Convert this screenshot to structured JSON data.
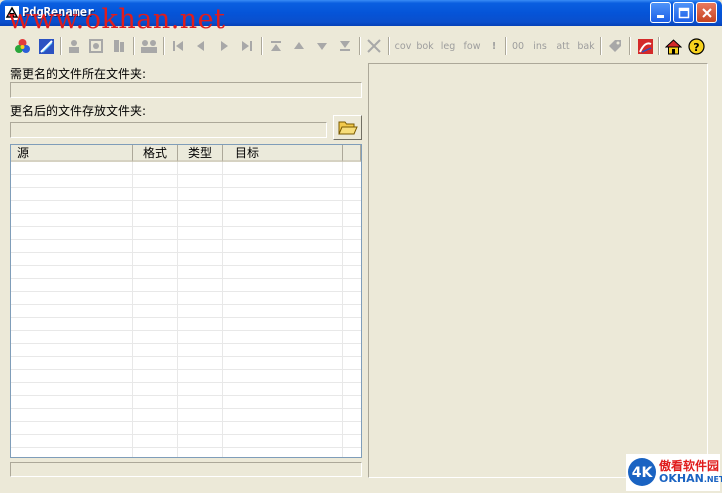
{
  "window": {
    "title": "PdgRenamer",
    "watermark_top": "www.okhan.net",
    "controls": [
      "minimize",
      "maximize",
      "close"
    ]
  },
  "toolbar": {
    "icons": [
      "color-wheel-icon",
      "rename-icon",
      "user-icon",
      "photo-icon",
      "document-icon",
      "group-icon",
      "first-icon",
      "previous-icon",
      "next-icon",
      "last-icon",
      "move-top-icon",
      "move-up-icon",
      "move-down-icon",
      "move-bottom-icon",
      "delete-icon",
      "tag-icon",
      "logo-icon",
      "home-icon",
      "help-icon"
    ],
    "text_buttons": {
      "cov": "cov",
      "bok": "bok",
      "leg": "leg",
      "fow": "fow",
      "excl": "!",
      "zero": "00",
      "ins": "ins",
      "att": "att",
      "bak": "bak"
    }
  },
  "source": {
    "label": "需更名的文件所在文件夹:",
    "value": ""
  },
  "target": {
    "label": "更名后的文件存放文件夹:",
    "value": ""
  },
  "file_list": {
    "columns": [
      "源",
      "格式",
      "类型",
      "目标"
    ],
    "rows": []
  },
  "status": "",
  "watermark_bottom": {
    "cn": "傲看软件园",
    "en": "OKHAN",
    "en_suffix": ".NET"
  },
  "colors": {
    "titlebar": "#0554d8",
    "face": "#ece9d8",
    "watermark": "#e01c1c"
  }
}
